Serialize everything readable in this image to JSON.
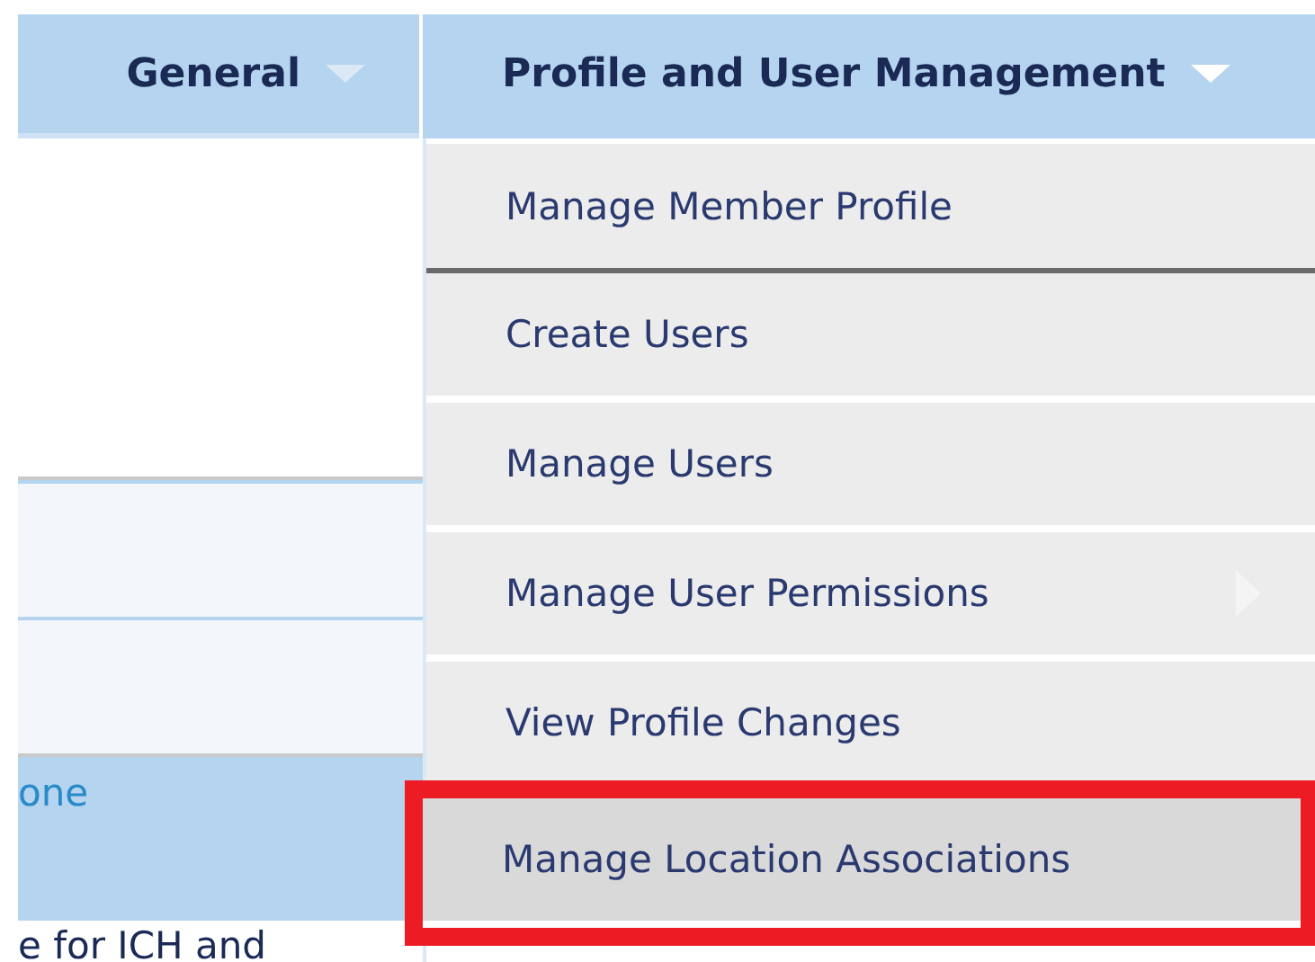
{
  "nav_tabs": [
    {
      "label": "General",
      "selected": false
    },
    {
      "label": "Profile and User Management",
      "selected": true
    }
  ],
  "dropdown_menu": {
    "items": [
      {
        "label": "Manage Member Profile",
        "kind": "plain",
        "selected": false,
        "highlighted": false
      },
      {
        "label": "Create Users",
        "kind": "plain",
        "selected": false,
        "highlighted": false
      },
      {
        "label": "Manage Users",
        "kind": "plain",
        "selected": false,
        "highlighted": false
      },
      {
        "label": "Manage User Permissions",
        "kind": "submenu",
        "selected": false,
        "highlighted": false
      },
      {
        "label": "View Profile Changes",
        "kind": "plain",
        "selected": false,
        "highlighted": false
      },
      {
        "label": "Manage Location Associations",
        "kind": "plain",
        "selected": true,
        "highlighted": true
      }
    ]
  },
  "background_panel": {
    "blue_row_text": "one",
    "bottom_cell_text": "e for ICH and"
  }
}
